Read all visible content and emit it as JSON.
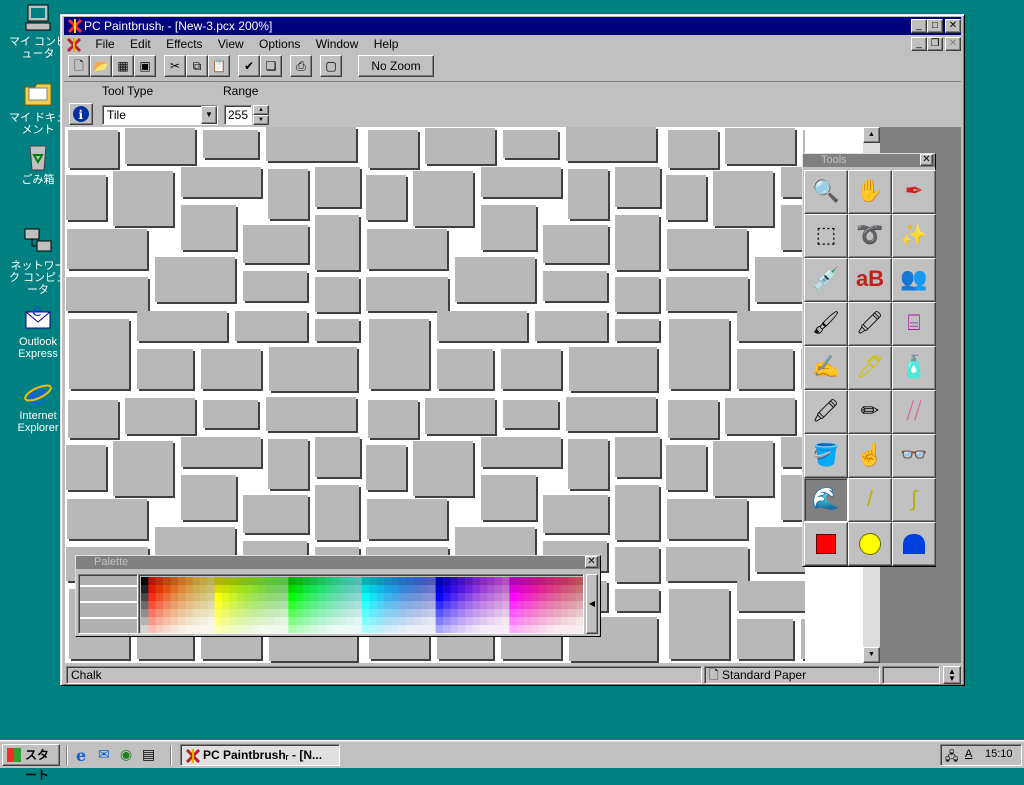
{
  "desktop": {
    "icons": [
      {
        "label": "マイ コンピュータ",
        "icon": "my-computer-icon"
      },
      {
        "label": "マイ ドキュメント",
        "icon": "my-documents-icon"
      },
      {
        "label": "ごみ箱",
        "icon": "recycle-bin-icon"
      },
      {
        "label": "ネットワーク コンピュータ",
        "icon": "network-icon"
      },
      {
        "label": "Outlook Express",
        "icon": "outlook-express-icon"
      },
      {
        "label": "Internet Explorer",
        "icon": "internet-explorer-icon"
      }
    ]
  },
  "window": {
    "title": "PC Paintbrushᵣ - [New-3.pcx  200%]",
    "controls": {
      "minimize": "_",
      "maximize": "□",
      "close": "✕"
    }
  },
  "menu": [
    "File",
    "Edit",
    "Effects",
    "View",
    "Options",
    "Window",
    "Help"
  ],
  "toolbar": {
    "nozoom": "No Zoom"
  },
  "options": {
    "tool_type_label": "Tool Type",
    "range_label": "Range",
    "tool_type_value": "Tile",
    "range_value": "255"
  },
  "tools_panel": {
    "title": "Tools"
  },
  "palette_panel": {
    "title": "Palette"
  },
  "status": {
    "left": "Chalk",
    "paper": "Standard Paper"
  },
  "taskbar": {
    "start": "スタート",
    "task": "PC Paintbrushᵣ - [N...",
    "clock": "15:10"
  },
  "colors": {
    "title_active": "#000080",
    "desktop": "#008080",
    "face": "#c0c0c0"
  }
}
